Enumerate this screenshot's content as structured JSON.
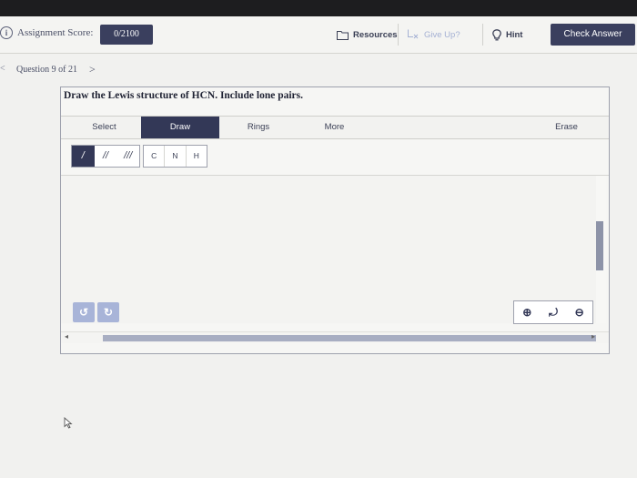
{
  "header": {
    "score_label": "Assignment Score:",
    "score_value": "0/2100",
    "resources_label": "Resources",
    "giveup_label": "Give Up?",
    "hint_label": "Hint",
    "check_label": "Check Answer",
    "info_icon": "i"
  },
  "navigation": {
    "back_glyph": "<",
    "question_label": "Question 9 of 21",
    "next_glyph": ">"
  },
  "question": {
    "prompt": "Draw the Lewis structure of HCN. Include lone pairs."
  },
  "editor": {
    "modes": {
      "select": "Select",
      "draw": "Draw",
      "rings": "Rings",
      "more": "More",
      "erase": "Erase"
    },
    "active_mode": "Draw",
    "bonds": [
      "/",
      "//",
      "///"
    ],
    "atoms": [
      "C",
      "N",
      "H"
    ],
    "undo_glyph": "↺",
    "redo_glyph": "↻",
    "zoom": {
      "in": "⊕",
      "reset": "⤾",
      "out": "⊖"
    },
    "scroll_left": "◂",
    "scroll_right": "▸"
  },
  "colors": {
    "accent": "#333857",
    "giveup": "#a5b1d4",
    "panel_border": "#9ea1ad"
  }
}
